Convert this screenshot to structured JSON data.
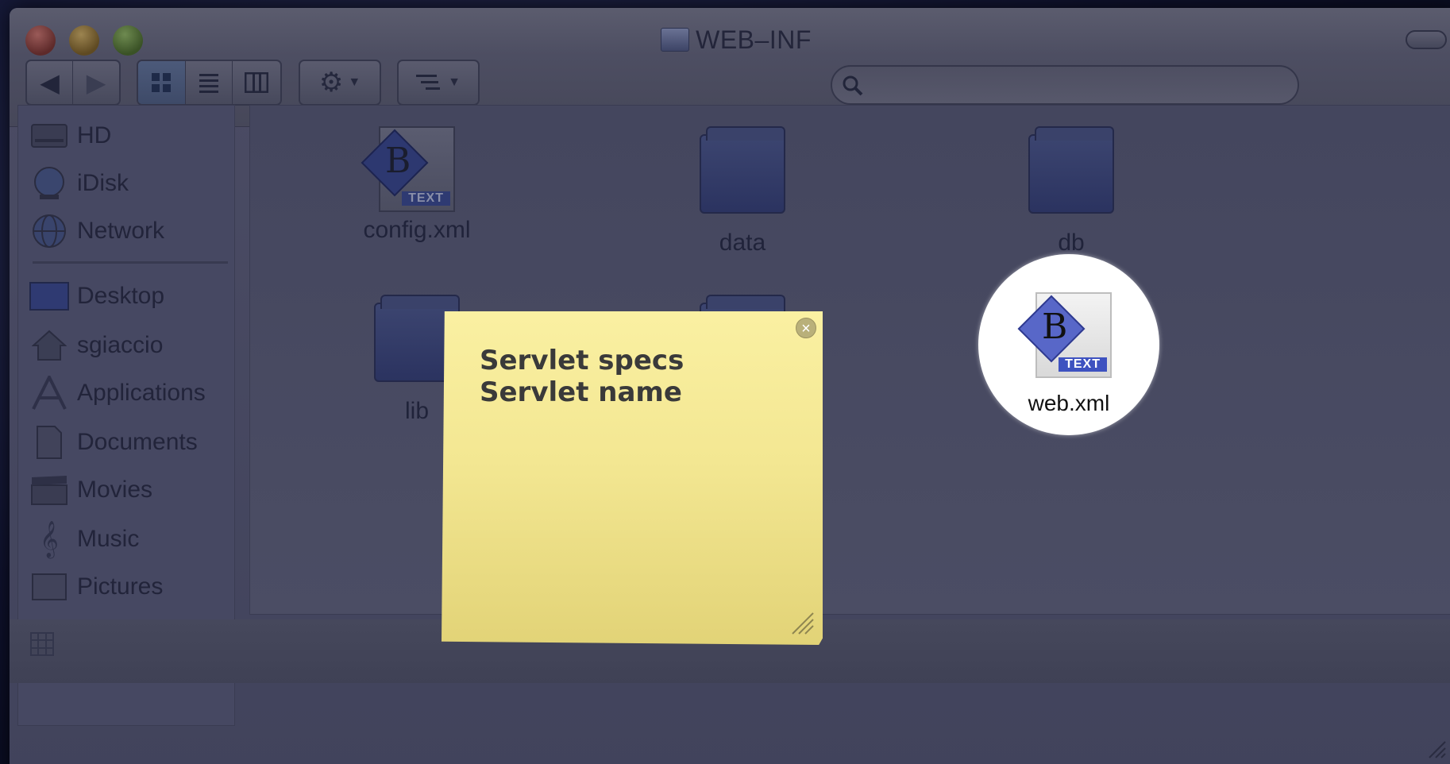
{
  "window": {
    "title": "WEB–INF"
  },
  "sidebar": {
    "items": [
      {
        "label": "HD",
        "icon": "hard-drive-icon"
      },
      {
        "label": "iDisk",
        "icon": "idisk-icon"
      },
      {
        "label": "Network",
        "icon": "network-icon"
      },
      {
        "label": "Desktop",
        "icon": "desktop-icon"
      },
      {
        "label": "sgiaccio",
        "icon": "home-icon"
      },
      {
        "label": "Applications",
        "icon": "applications-icon"
      },
      {
        "label": "Documents",
        "icon": "documents-icon"
      },
      {
        "label": "Movies",
        "icon": "movies-icon"
      },
      {
        "label": "Music",
        "icon": "music-icon"
      },
      {
        "label": "Pictures",
        "icon": "pictures-icon"
      }
    ]
  },
  "files": {
    "config": {
      "name": "config.xml",
      "badge": "TEXT"
    },
    "data": {
      "name": "data"
    },
    "db": {
      "name": "db"
    },
    "lib": {
      "name": "lib"
    },
    "web": {
      "name": "web.xml",
      "badge": "TEXT"
    }
  },
  "sticky": {
    "line1": "Servlet specs",
    "line2": "Servlet name"
  },
  "colors": {
    "sticky": "#f6ea97",
    "spotlight": "#ffffff",
    "dim_window": "#464862"
  }
}
